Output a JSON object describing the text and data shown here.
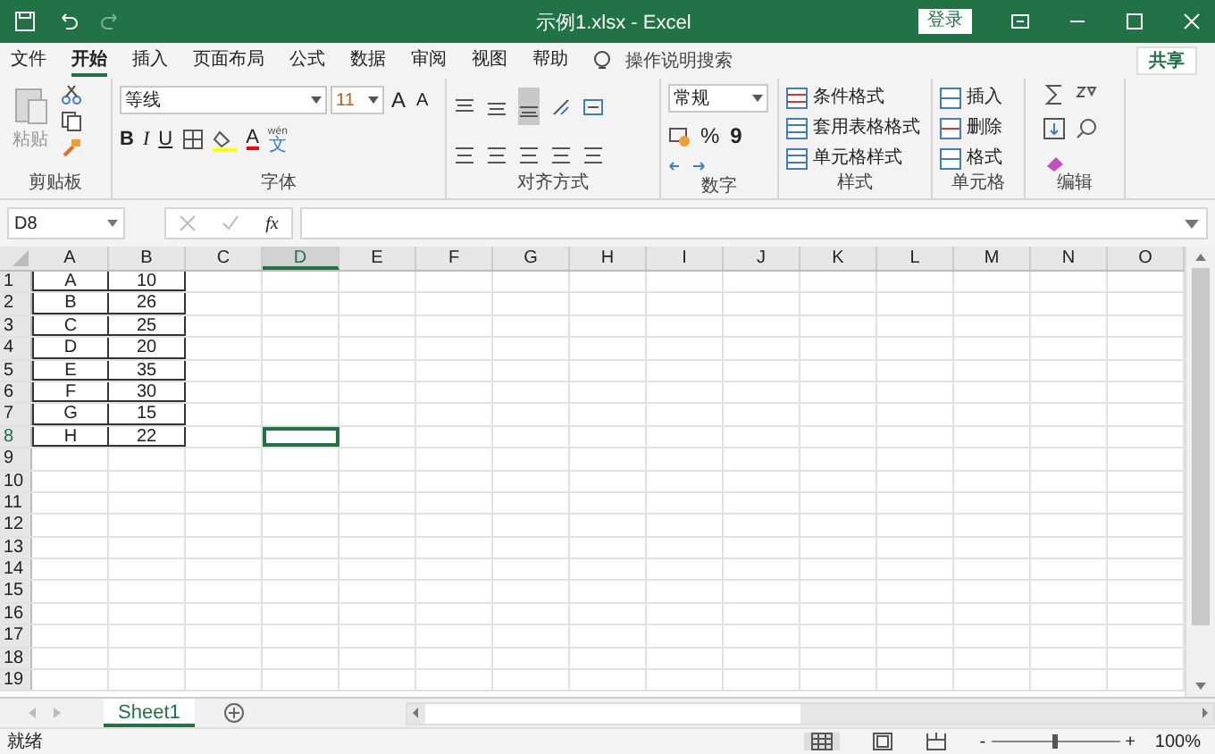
{
  "window": {
    "title": "示例1.xlsx  -  Excel",
    "login": "登录"
  },
  "tabs": [
    {
      "label": "文件",
      "selected": false
    },
    {
      "label": "开始",
      "selected": true
    },
    {
      "label": "插入",
      "selected": false
    },
    {
      "label": "页面布局",
      "selected": false
    },
    {
      "label": "公式",
      "selected": false
    },
    {
      "label": "数据",
      "selected": false
    },
    {
      "label": "审阅",
      "selected": false
    },
    {
      "label": "视图",
      "selected": false
    },
    {
      "label": "帮助",
      "selected": false
    }
  ],
  "tell_me": {
    "placeholder": "操作说明搜索"
  },
  "share": "共享",
  "ribbon": {
    "clipboard": {
      "paste": "粘贴",
      "label": "剪贴板"
    },
    "font": {
      "name": "等线",
      "size": "11",
      "label": "字体",
      "bold": "B",
      "italic": "I",
      "underline": "U",
      "grow": "A",
      "shrink": "A",
      "color_letter": "A",
      "phonetic_top": "wén",
      "phonetic_bottom": "文"
    },
    "alignment": {
      "label": "对齐方式"
    },
    "number": {
      "format": "常规",
      "percent": "%",
      "comma": "9",
      "label": "数字"
    },
    "styles": {
      "items": [
        "条件格式",
        "套用表格格式",
        "单元格样式"
      ],
      "label": "样式"
    },
    "cells": {
      "items": [
        "插入",
        "删除",
        "格式"
      ],
      "label": "单元格"
    },
    "editing": {
      "label": "编辑"
    }
  },
  "formula_bar": {
    "name_box": "D8",
    "fx": "fx"
  },
  "columns": [
    {
      "label": "A",
      "selected": false
    },
    {
      "label": "B",
      "selected": false
    },
    {
      "label": "C",
      "selected": false
    },
    {
      "label": "D",
      "selected": true
    },
    {
      "label": "E",
      "selected": false
    },
    {
      "label": "F",
      "selected": false
    },
    {
      "label": "G",
      "selected": false
    },
    {
      "label": "H",
      "selected": false
    },
    {
      "label": "I",
      "selected": false
    },
    {
      "label": "J",
      "selected": false
    },
    {
      "label": "K",
      "selected": false
    },
    {
      "label": "L",
      "selected": false
    },
    {
      "label": "M",
      "selected": false
    },
    {
      "label": "N",
      "selected": false
    },
    {
      "label": "O",
      "selected": false
    }
  ],
  "rows": [
    {
      "label": "1",
      "selected": false,
      "cells": [
        "A",
        "10"
      ]
    },
    {
      "label": "2",
      "selected": false,
      "cells": [
        "B",
        "26"
      ]
    },
    {
      "label": "3",
      "selected": false,
      "cells": [
        "C",
        "25"
      ]
    },
    {
      "label": "4",
      "selected": false,
      "cells": [
        "D",
        "20"
      ]
    },
    {
      "label": "5",
      "selected": false,
      "cells": [
        "E",
        "35"
      ]
    },
    {
      "label": "6",
      "selected": false,
      "cells": [
        "F",
        "30"
      ]
    },
    {
      "label": "7",
      "selected": false,
      "cells": [
        "G",
        "15"
      ]
    },
    {
      "label": "8",
      "selected": true,
      "cells": [
        "H",
        "22"
      ]
    },
    {
      "label": "9",
      "selected": false,
      "cells": []
    },
    {
      "label": "10",
      "selected": false,
      "cells": []
    },
    {
      "label": "11",
      "selected": false,
      "cells": []
    },
    {
      "label": "12",
      "selected": false,
      "cells": []
    },
    {
      "label": "13",
      "selected": false,
      "cells": []
    },
    {
      "label": "14",
      "selected": false,
      "cells": []
    },
    {
      "label": "15",
      "selected": false,
      "cells": []
    },
    {
      "label": "16",
      "selected": false,
      "cells": []
    },
    {
      "label": "17",
      "selected": false,
      "cells": []
    },
    {
      "label": "18",
      "selected": false,
      "cells": []
    },
    {
      "label": "19",
      "selected": false,
      "cells": []
    }
  ],
  "sheets": [
    {
      "label": "Sheet1",
      "selected": true
    }
  ],
  "status_bar": {
    "status": "就绪",
    "zoom": "100%",
    "minus": "-",
    "plus": "+"
  }
}
